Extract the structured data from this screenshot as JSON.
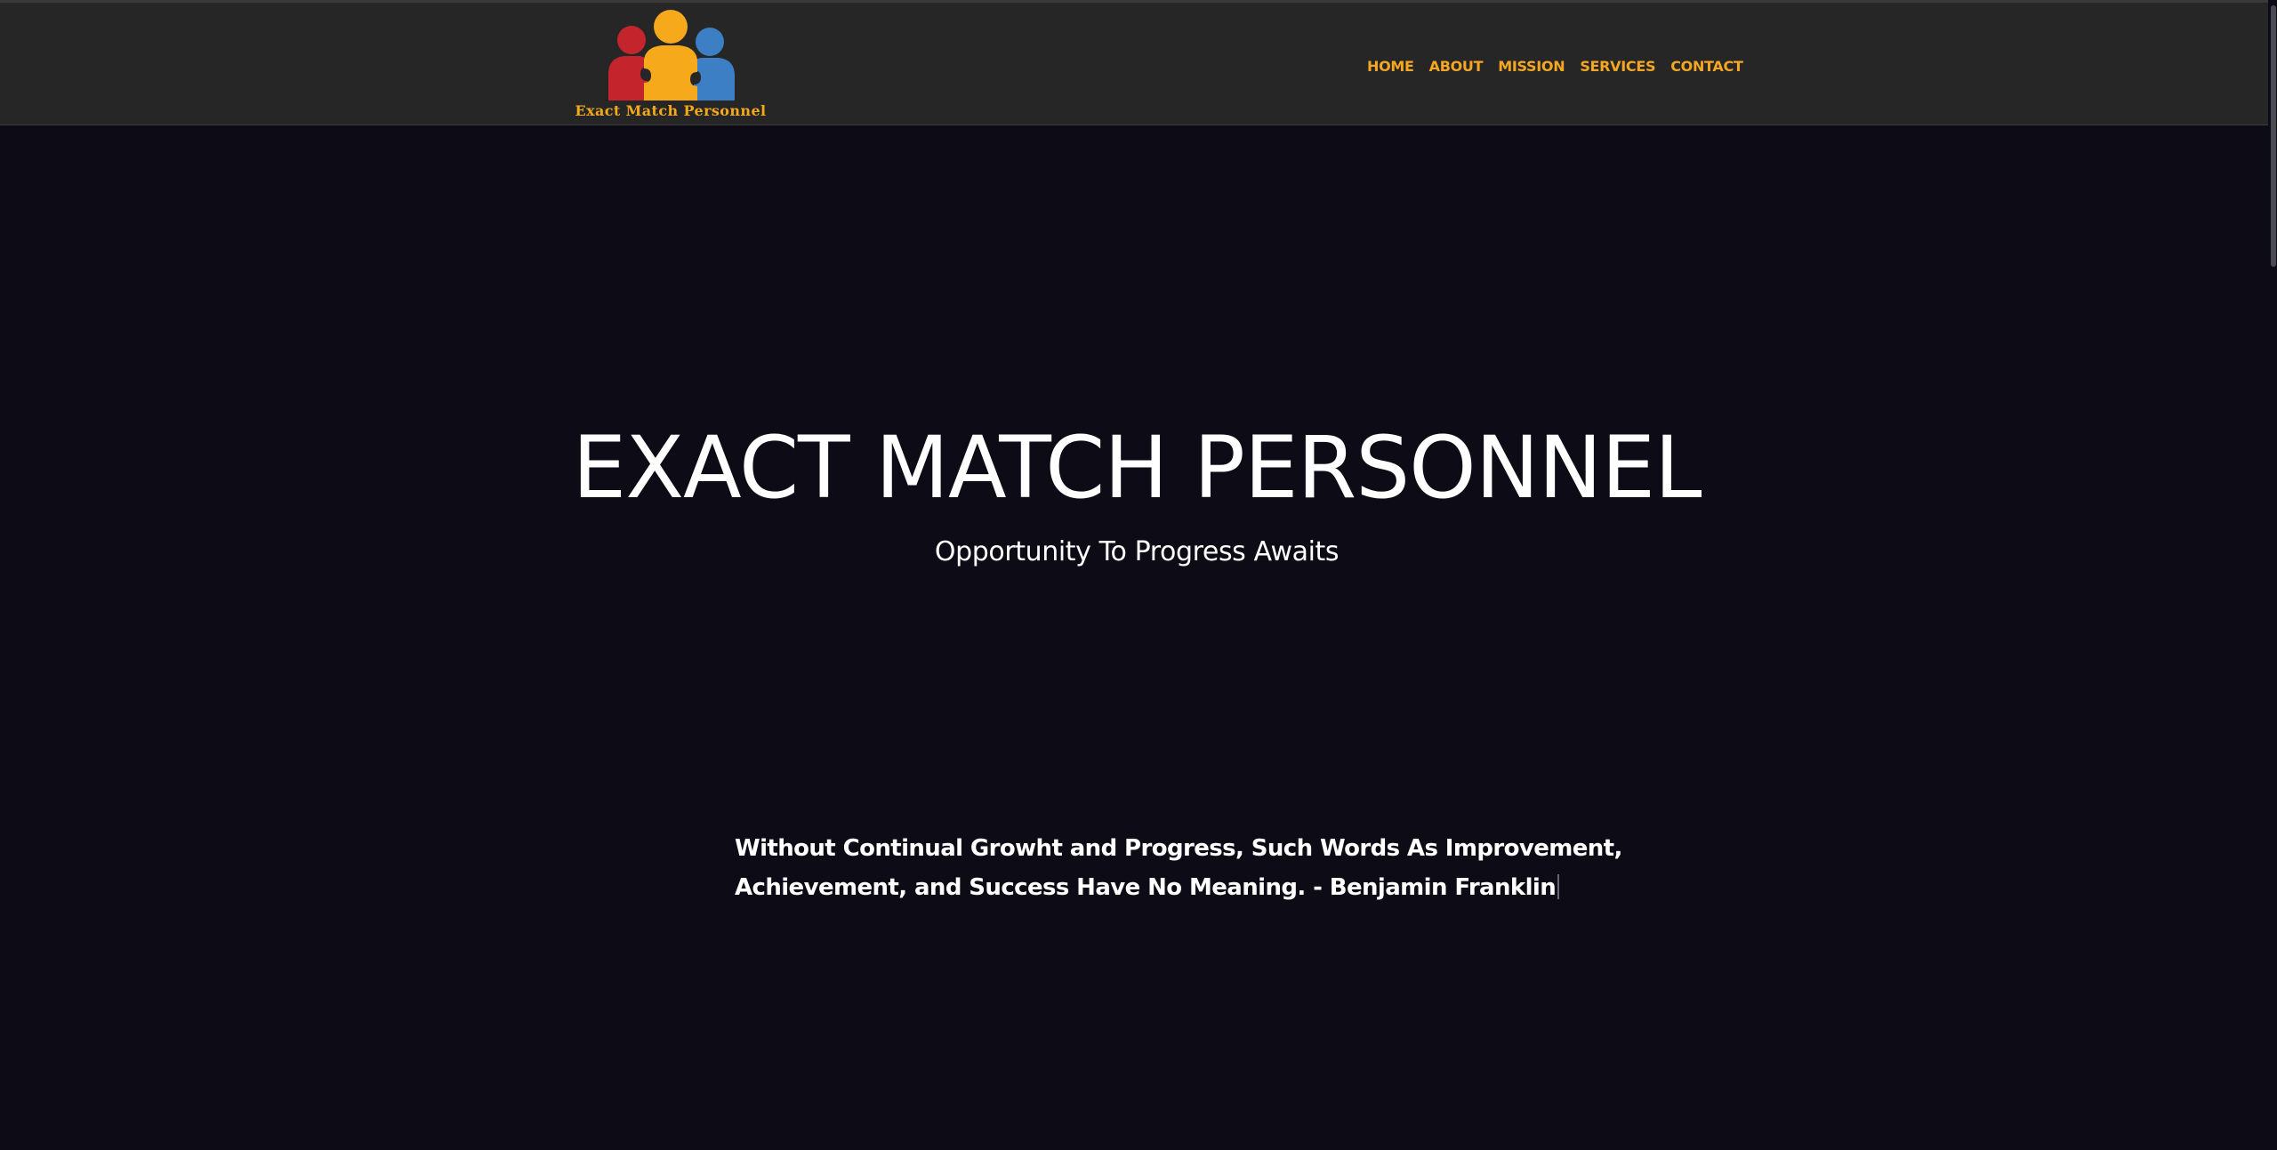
{
  "brand": {
    "logo_text": "Exact Match Personnel",
    "icon": "three-people-puzzle-logo",
    "colors": {
      "red": "#c4252c",
      "yellow": "#f5a91b",
      "blue": "#3d7fc4",
      "base": "#1c1c1c"
    }
  },
  "nav": {
    "items": [
      {
        "label": "HOME"
      },
      {
        "label": "ABOUT"
      },
      {
        "label": "MISSION"
      },
      {
        "label": "SERVICES"
      },
      {
        "label": "CONTACT"
      }
    ],
    "color": "#f5a623"
  },
  "hero": {
    "title": "EXACT MATCH PERSONNEL",
    "subtitle": "Opportunity To Progress Awaits"
  },
  "quote": {
    "line1": "Without Continual Growht and Progress, Such Words As Improvement,",
    "line2": "Achievement, and Success Have No Meaning. - Benjamin Franklin"
  },
  "theme": {
    "background": "#0d0c16",
    "header_background": "#262626",
    "text": "#ffffff"
  }
}
